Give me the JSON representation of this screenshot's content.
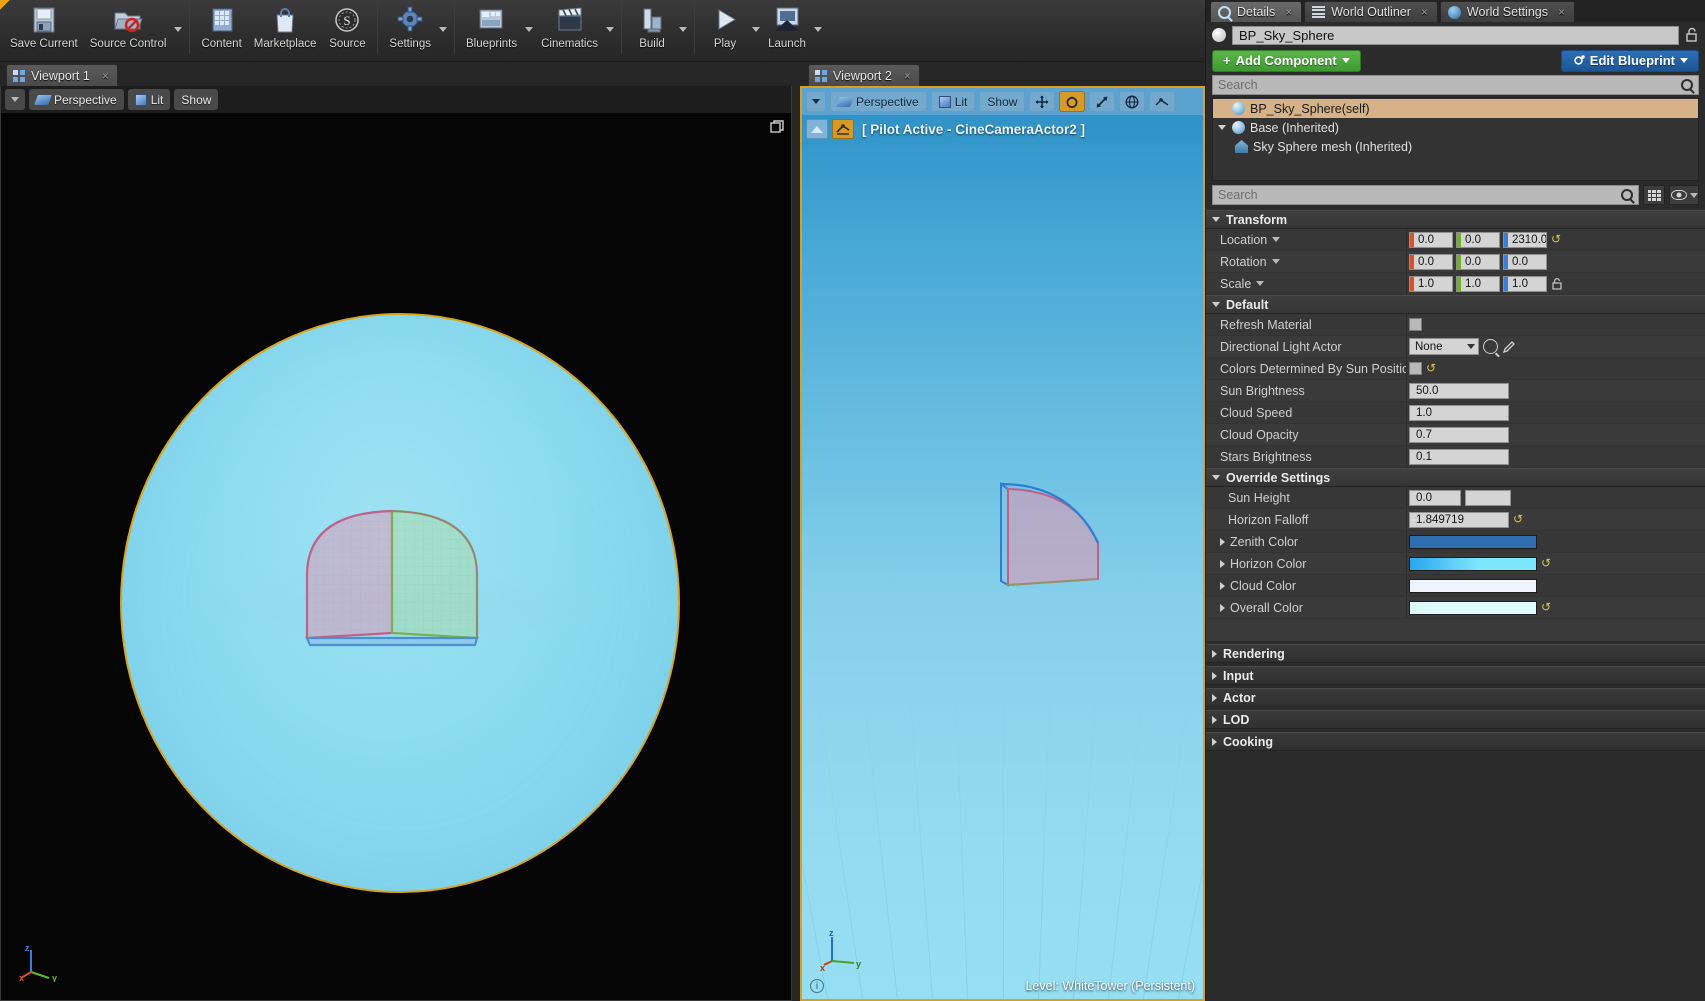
{
  "toolbar": {
    "groups": [
      {
        "items": [
          {
            "label": "Save Current",
            "icon": "save-icon",
            "dropdown": false
          },
          {
            "label": "Source Control",
            "icon": "source-control-icon",
            "dropdown": true
          }
        ]
      },
      {
        "items": [
          {
            "label": "Content",
            "icon": "content-browser-icon",
            "dropdown": false
          },
          {
            "label": "Marketplace",
            "icon": "marketplace-icon",
            "dropdown": false
          },
          {
            "label": "Source",
            "icon": "source-icon",
            "dropdown": false
          }
        ]
      },
      {
        "items": [
          {
            "label": "Settings",
            "icon": "settings-gear-icon",
            "dropdown": true
          }
        ]
      },
      {
        "items": [
          {
            "label": "Blueprints",
            "icon": "blueprints-icon",
            "dropdown": true
          },
          {
            "label": "Cinematics",
            "icon": "cinematics-clapboard-icon",
            "dropdown": true
          }
        ]
      },
      {
        "items": [
          {
            "label": "Build",
            "icon": "build-icon",
            "dropdown": true
          }
        ]
      },
      {
        "items": [
          {
            "label": "Play",
            "icon": "play-triangle-icon",
            "dropdown": true
          },
          {
            "label": "Launch",
            "icon": "launch-icon",
            "dropdown": true
          }
        ]
      }
    ]
  },
  "viewport1": {
    "tab_label": "Viewport 1",
    "toolbar": {
      "view_dropdown": "view-options-dropdown",
      "perspective_label": "Perspective",
      "lit_label": "Lit",
      "show_label": "Show"
    },
    "gizmo": {
      "x": "x",
      "y": "y",
      "z": "z"
    },
    "maximize_icon": "maximize-viewport-icon"
  },
  "viewport2": {
    "tab_label": "Viewport 2",
    "toolbar": {
      "view_dropdown": "view-options-dropdown",
      "perspective_label": "Perspective",
      "lit_label": "Lit",
      "show_label": "Show",
      "icons": [
        "translate-mode-icon",
        "rotate-mode-icon",
        "scale-mode-icon",
        "world-coordinate-icon",
        "surface-snap-icon"
      ]
    },
    "pilot_text": "[ Pilot Active - CineCameraActor2 ]",
    "eject_icon": "eject-pilot-icon",
    "camera_icon": "cine-camera-icon",
    "level_label": "Level:  WhiteTower (Persistent)",
    "gizmo": {
      "x": "x",
      "y": "y",
      "z": "z"
    },
    "border_color": "#d9a020"
  },
  "right_panel": {
    "dock_tabs": [
      {
        "label": "Details",
        "icon": "details-magnifier-icon",
        "active": true
      },
      {
        "label": "World Outliner",
        "icon": "world-outliner-list-icon",
        "active": false
      },
      {
        "label": "World Settings",
        "icon": "world-settings-globe-icon",
        "active": false
      }
    ],
    "actor_name": "BP_Sky_Sphere",
    "lock_icon": "unlocked-padlock-icon",
    "add_component_label": "Add Component",
    "edit_blueprint_label": "Edit Blueprint",
    "component_search_placeholder": "Search",
    "component_tree": [
      {
        "label": "BP_Sky_Sphere(self)",
        "icon": "sphere-icon",
        "indent": 0,
        "selected": true,
        "expander": "none"
      },
      {
        "label": "Base (Inherited)",
        "icon": "sphere-icon",
        "indent": 1,
        "selected": false,
        "expander": "down"
      },
      {
        "label": "Sky Sphere mesh (Inherited)",
        "icon": "static-mesh-icon",
        "indent": 2,
        "selected": false,
        "expander": "none"
      }
    ],
    "details_search_placeholder": "Search",
    "details_buttons": [
      "display-grid-icon",
      "visibility-eye-icon"
    ],
    "categories": [
      {
        "name": "Transform",
        "collapsed": false,
        "rows": [
          {
            "label": "Location",
            "type": "vector3",
            "has_label_dropdown": true,
            "values": [
              "0.0",
              "0.0",
              "2310.0"
            ],
            "has_reset": true
          },
          {
            "label": "Rotation",
            "type": "vector3",
            "has_label_dropdown": true,
            "values": [
              "0.0",
              "0.0",
              "0.0"
            ],
            "has_reset": false
          },
          {
            "label": "Scale",
            "type": "vector3",
            "has_label_dropdown": true,
            "values": [
              "1.0",
              "1.0",
              "1.0"
            ],
            "has_lock": true
          }
        ]
      },
      {
        "name": "Default",
        "collapsed": false,
        "rows": [
          {
            "label": "Refresh Material",
            "type": "checkbox",
            "checked": false
          },
          {
            "label": "Directional Light Actor",
            "type": "object-combo",
            "value": "None",
            "extra_icons": [
              "browse-icon",
              "eyedropper-icon"
            ]
          },
          {
            "label": "Colors Determined By Sun Position",
            "type": "checkbox",
            "checked": false,
            "has_reset": true
          },
          {
            "label": "Sun Brightness",
            "type": "number",
            "value": "50.0"
          },
          {
            "label": "Cloud Speed",
            "type": "number",
            "value": "1.0"
          },
          {
            "label": "Cloud Opacity",
            "type": "number",
            "value": "0.7"
          },
          {
            "label": "Stars Brightness",
            "type": "number",
            "value": "0.1"
          }
        ]
      },
      {
        "name": "Override Settings",
        "collapsed": false,
        "rows": [
          {
            "label": "Sun Height",
            "type": "number-narrow",
            "value": "0.0"
          },
          {
            "label": "Horizon Falloff",
            "type": "number",
            "value": "1.849719",
            "has_reset": true
          },
          {
            "label": "Zenith Color",
            "type": "color",
            "expandable": true,
            "color": "#2f6fb0"
          },
          {
            "label": "Horizon Color",
            "type": "color-gradient",
            "expandable": true,
            "color": "#29a6ef",
            "color2": "#7fe6ff",
            "has_reset": true
          },
          {
            "label": "Cloud Color",
            "type": "color",
            "expandable": true,
            "color": "#eef4fb"
          },
          {
            "label": "Overall Color",
            "type": "color",
            "expandable": true,
            "color": "#ddfbfb",
            "has_reset": true
          }
        ]
      },
      {
        "name": "Rendering",
        "collapsed": true,
        "rows": []
      },
      {
        "name": "Input",
        "collapsed": true,
        "rows": []
      },
      {
        "name": "Actor",
        "collapsed": true,
        "rows": []
      },
      {
        "name": "LOD",
        "collapsed": true,
        "rows": []
      },
      {
        "name": "Cooking",
        "collapsed": true,
        "rows": []
      }
    ]
  },
  "colors": {
    "axis_x": "#d8512a",
    "axis_y": "#71b12a",
    "axis_z": "#3b7fd4",
    "accent_green": "#4aa63a",
    "accent_blue": "#2461a8",
    "viewport_border": "#d9a020",
    "selection": "#d5b288"
  }
}
